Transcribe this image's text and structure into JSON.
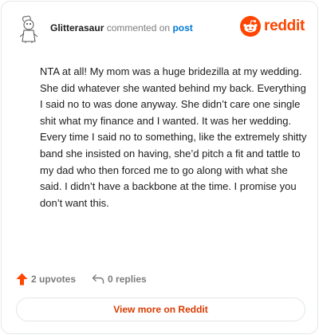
{
  "comment": {
    "username": "Glitterasaur",
    "verb": "commented on",
    "target": "post",
    "body": "NTA at all! My mom was a huge bridezilla at my wedding. She did whatever she wanted behind my back. Everything I said no to was done anyway. She didn’t care one single shit what my finance and I wanted. It was her wedding. Every time I said no to something, like the extremely shitty band she insisted on having, she’d pitch a fit and tattle to my dad who then forced me to go along with what she said. I didn’t have a backbone at the time. I promise you don’t want this."
  },
  "brand": {
    "wordmark": "reddit",
    "color": "#ff4500",
    "icon": "reddit-snoo-icon"
  },
  "actions": {
    "upvotes_label": "2 upvotes",
    "replies_label": "0 replies",
    "upvote_icon": "upvote-arrow-icon",
    "reply_icon": "reply-arrow-icon",
    "upvote_color": "#ff4500"
  },
  "cta": {
    "label": "View more on Reddit",
    "color": "#d93a00"
  }
}
